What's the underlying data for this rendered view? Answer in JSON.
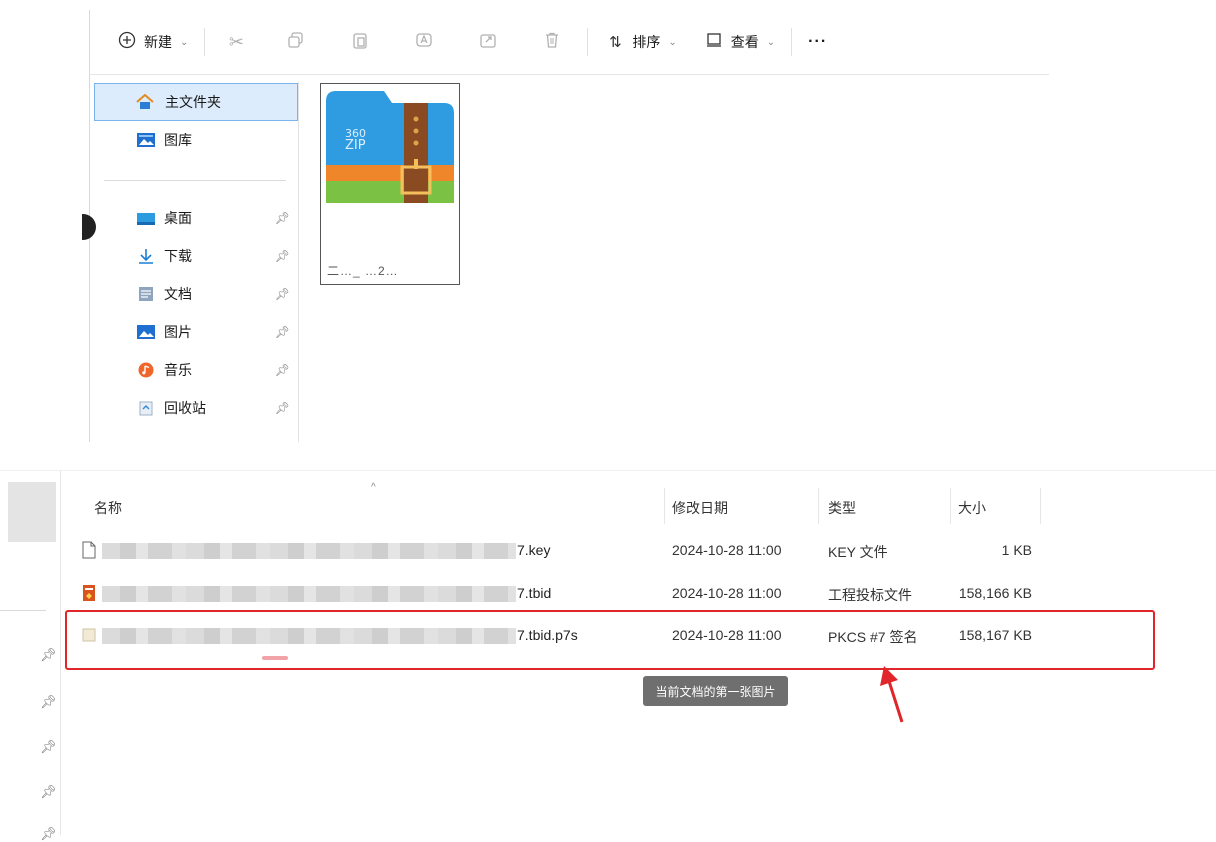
{
  "toolbar": {
    "new_label": "新建",
    "sort_label": "排序",
    "view_label": "查看",
    "more_label": "···"
  },
  "nav": {
    "items": [
      {
        "label": "主文件夹",
        "selected": true
      },
      {
        "label": "图库"
      },
      {
        "label": "桌面",
        "pinned": true
      },
      {
        "label": "下载",
        "pinned": true
      },
      {
        "label": "文档",
        "pinned": true
      },
      {
        "label": "图片",
        "pinned": true
      },
      {
        "label": "音乐",
        "pinned": true
      },
      {
        "label": "回收站",
        "pinned": true
      }
    ]
  },
  "tile": {
    "brand_line1": "360",
    "brand_line2": "ZIP",
    "caption": "二…_ …2…"
  },
  "list": {
    "columns": {
      "name": "名称",
      "modified": "修改日期",
      "type": "类型",
      "size": "大小"
    },
    "rows": [
      {
        "name_suffix": "7.key",
        "modified": "2024-10-28 11:00",
        "type": "KEY 文件",
        "size": "1 KB"
      },
      {
        "name_suffix": "7.tbid",
        "modified": "2024-10-28 11:00",
        "type": "工程投标文件",
        "size": "158,166 KB"
      },
      {
        "name_suffix": "7.tbid.p7s",
        "modified": "2024-10-28 11:00",
        "type": "PKCS #7 签名",
        "size": "158,167 KB"
      }
    ]
  },
  "tooltip": {
    "text": "当前文档的第一张图片"
  },
  "colors": {
    "accent_blue": "#1a73c8",
    "highlight_red": "#e0262a",
    "selection_bg": "#dcecfc"
  }
}
